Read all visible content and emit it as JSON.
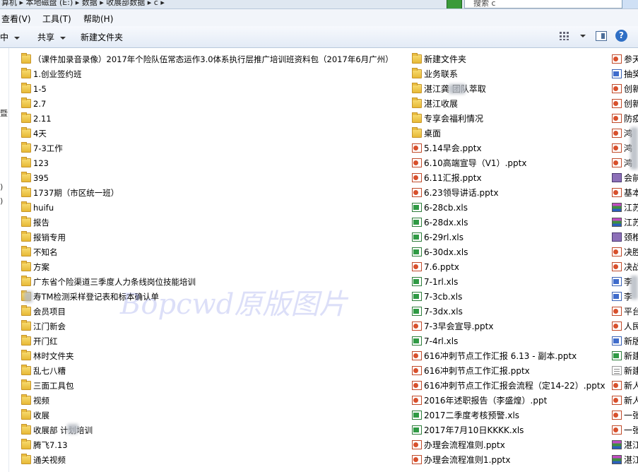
{
  "window": {
    "address_path": "算机 ▸ 本地磁盘 (E:) ▸ 数据 ▸ 收展部数据 ▸ c ▸",
    "search_placeholder": "搜索 c"
  },
  "menu": [
    "查看(V)",
    "工具(T)",
    "帮助(H)"
  ],
  "toolbar": {
    "organize_label": "中",
    "share_label": "共享",
    "new_folder_label": "新建文件夹"
  },
  "left_pane_fragments": [
    "暨",
    ")",
    ")"
  ],
  "watermark": "Bopcwd原版图片",
  "columns": [
    [
      {
        "type": "folder",
        "name": "（课件加录音录像）2017年个险队伍常态运作3.0体系执行层推广培训班资料包（2017年6月广州）"
      },
      {
        "type": "folder",
        "name": "1.创业签约班"
      },
      {
        "type": "folder",
        "name": "1-5"
      },
      {
        "type": "folder",
        "name": "2.7"
      },
      {
        "type": "folder",
        "name": "2.11"
      },
      {
        "type": "folder",
        "name": "4天"
      },
      {
        "type": "folder",
        "name": "7-3工作"
      },
      {
        "type": "folder",
        "name": "123"
      },
      {
        "type": "folder",
        "name": "395"
      },
      {
        "type": "folder",
        "name": "1737期（市区统一班）"
      },
      {
        "type": "folder",
        "name": "huifu"
      },
      {
        "type": "folder",
        "name": "报告"
      },
      {
        "type": "folder",
        "name": "报销专用"
      },
      {
        "type": "folder",
        "name": "不知名"
      },
      {
        "type": "folder",
        "name": "方案"
      },
      {
        "type": "folder",
        "name": "广东省个险渠道三季度人力条线岗位技能培训"
      },
      {
        "type": "folder",
        "name": "寿TM检测采样登记表和标本确认单"
      },
      {
        "type": "folder",
        "name": "会员项目"
      },
      {
        "type": "folder",
        "name": "江门新会"
      },
      {
        "type": "folder",
        "name": "开门红"
      },
      {
        "type": "folder",
        "name": "林时文件夹"
      },
      {
        "type": "folder",
        "name": "乱七八糟"
      },
      {
        "type": "folder",
        "name": "三面工具包"
      },
      {
        "type": "folder",
        "name": "视频"
      },
      {
        "type": "folder",
        "name": "收展"
      },
      {
        "type": "folder",
        "name": "收展部 计划培训"
      },
      {
        "type": "folder",
        "name": "腾飞7.13"
      },
      {
        "type": "folder",
        "name": "通关视频"
      }
    ],
    [
      {
        "type": "folder",
        "name": "新建文件夹"
      },
      {
        "type": "folder",
        "name": "业务联系"
      },
      {
        "type": "folder",
        "name": "湛江龚 团队萃取"
      },
      {
        "type": "folder",
        "name": "湛江收展"
      },
      {
        "type": "folder",
        "name": "专享会福利情况"
      },
      {
        "type": "folder",
        "name": "桌面"
      },
      {
        "type": "ppt",
        "name": "5.14早会.pptx"
      },
      {
        "type": "ppt",
        "name": "6.10高端宣导（V1）.pptx"
      },
      {
        "type": "ppt",
        "name": "6.11汇报.pptx"
      },
      {
        "type": "ppt",
        "name": "6.23领导讲话.pptx"
      },
      {
        "type": "xls",
        "name": "6-28cb.xls"
      },
      {
        "type": "xls",
        "name": "6-28dx.xls"
      },
      {
        "type": "xls",
        "name": "6-29rl.xls"
      },
      {
        "type": "xls",
        "name": "6-30dx.xls"
      },
      {
        "type": "ppt",
        "name": "7.6.pptx"
      },
      {
        "type": "xls",
        "name": "7-1rl.xls"
      },
      {
        "type": "xls",
        "name": "7-3cb.xls"
      },
      {
        "type": "xls",
        "name": "7-3dx.xls"
      },
      {
        "type": "ppt",
        "name": "7-3早会宣导.pptx"
      },
      {
        "type": "xls",
        "name": "7-4rl.xls"
      },
      {
        "type": "ppt",
        "name": "616冲刺节点工作汇报 6.13 - 副本.pptx"
      },
      {
        "type": "ppt",
        "name": "616冲刺节点工作汇报.pptx"
      },
      {
        "type": "ppt",
        "name": "616冲刺节点工作汇报会流程（定14-22）.pptx"
      },
      {
        "type": "ppt",
        "name": "2016年述职报告（李盛煌）.ppt"
      },
      {
        "type": "xls",
        "name": "2017二季度考核预警.xls"
      },
      {
        "type": "xls",
        "name": "2017年7月10日KKKK.xls"
      },
      {
        "type": "ppt",
        "name": "办理会流程准则.pptx"
      },
      {
        "type": "ppt",
        "name": "办理会流程准则1.pptx"
      }
    ],
    [
      {
        "type": "ppt",
        "name": "参天"
      },
      {
        "type": "doc",
        "name": "抽奖"
      },
      {
        "type": "ppt",
        "name": "创新"
      },
      {
        "type": "ppt",
        "name": "创新"
      },
      {
        "type": "ppt",
        "name": "防疫"
      },
      {
        "type": "ppt",
        "name": "鸿"
      },
      {
        "type": "ppt",
        "name": "鸿"
      },
      {
        "type": "ppt",
        "name": "鸿"
      },
      {
        "type": "rmv",
        "name": "会前"
      },
      {
        "type": "ppt",
        "name": "基本"
      },
      {
        "type": "rar",
        "name": "江苏"
      },
      {
        "type": "rar",
        "name": "江苏"
      },
      {
        "type": "rmv",
        "name": "颈椎"
      },
      {
        "type": "ppt",
        "name": "决胜"
      },
      {
        "type": "ppt",
        "name": "决战"
      },
      {
        "type": "doc",
        "name": "李"
      },
      {
        "type": "doc",
        "name": "李"
      },
      {
        "type": "ppt",
        "name": "平台"
      },
      {
        "type": "ppt",
        "name": "人民"
      },
      {
        "type": "doc",
        "name": "新版"
      },
      {
        "type": "xls",
        "name": "新建"
      },
      {
        "type": "txt",
        "name": "新建"
      },
      {
        "type": "ppt",
        "name": "新人"
      },
      {
        "type": "ppt",
        "name": "新人"
      },
      {
        "type": "ppt",
        "name": "一张"
      },
      {
        "type": "ppt",
        "name": "一张"
      },
      {
        "type": "rar",
        "name": "湛江"
      },
      {
        "type": "rar",
        "name": "湛江"
      }
    ]
  ]
}
